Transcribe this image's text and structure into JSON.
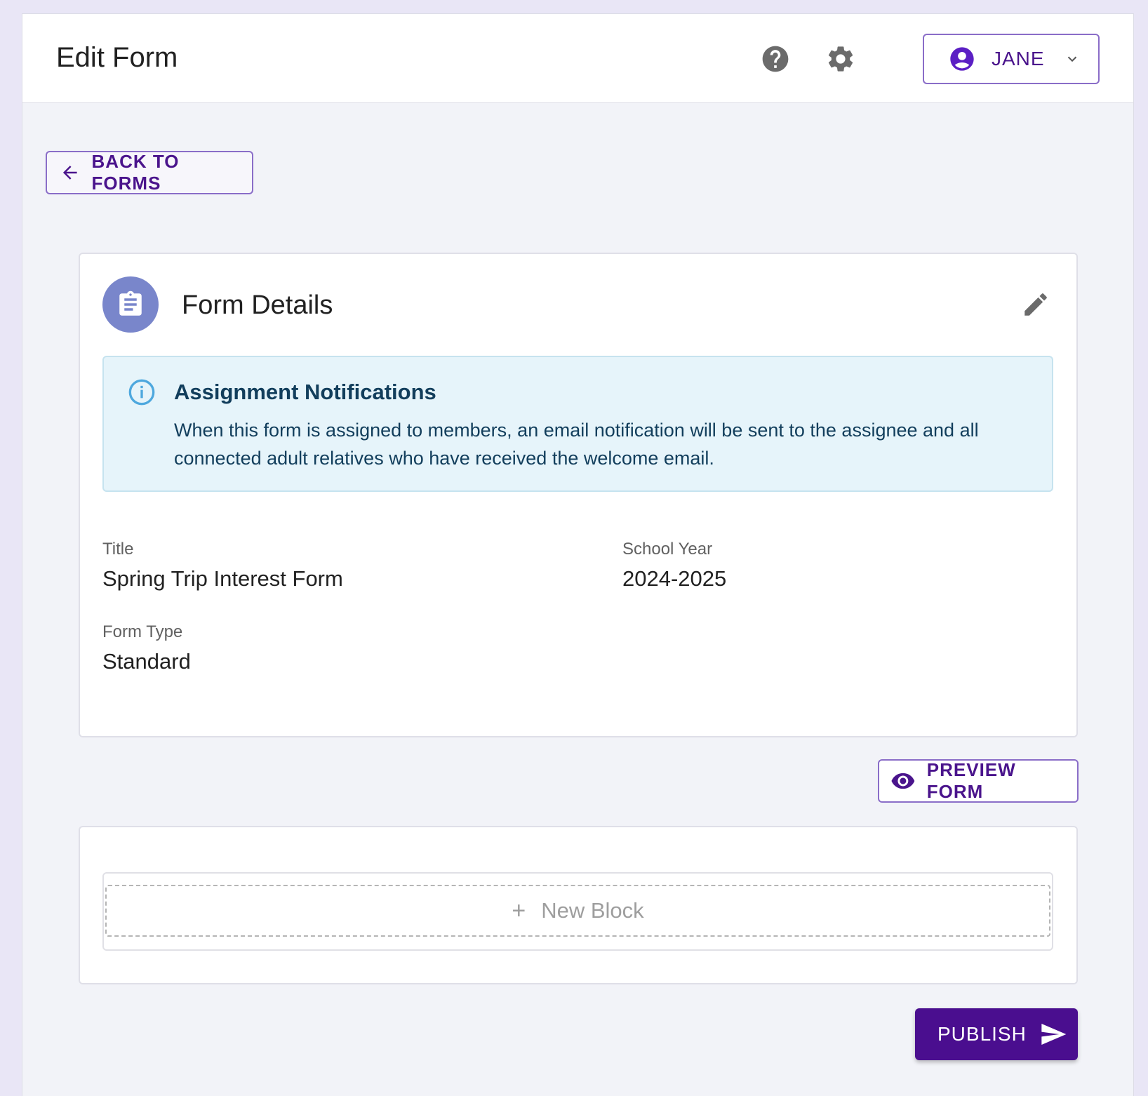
{
  "header": {
    "title": "Edit Form",
    "help_icon": "help-circle-icon",
    "settings_icon": "gear-icon",
    "user": {
      "name": "JANE",
      "avatar_icon": "account-circle-icon",
      "dropdown_icon": "chevron-down-icon"
    }
  },
  "nav": {
    "back_label": "BACK TO FORMS",
    "back_icon": "arrow-left-icon"
  },
  "details": {
    "title": "Form Details",
    "icon": "clipboard-icon",
    "edit_icon": "pencil-icon",
    "notice": {
      "icon": "info-icon",
      "title": "Assignment Notifications",
      "body": "When this form is assigned to members, an email notification will be sent to the assignee and all connected adult relatives who have received the welcome email."
    },
    "fields": {
      "title_label": "Title",
      "title_value": "Spring Trip Interest Form",
      "school_year_label": "School Year",
      "school_year_value": "2024-2025",
      "form_type_label": "Form Type",
      "form_type_value": "Standard"
    }
  },
  "actions": {
    "preview_label": "PREVIEW FORM",
    "preview_icon": "eye-icon",
    "new_block_plus": "+",
    "new_block_label": "New Block",
    "publish_label": "PUBLISH",
    "publish_icon": "send-icon"
  },
  "colors": {
    "primary": "#4a0e8f",
    "outline": "#8a6dc8",
    "avatar_bg": "#7986cb",
    "info_bg": "#e6f4fa",
    "info_text": "#123e5c"
  }
}
